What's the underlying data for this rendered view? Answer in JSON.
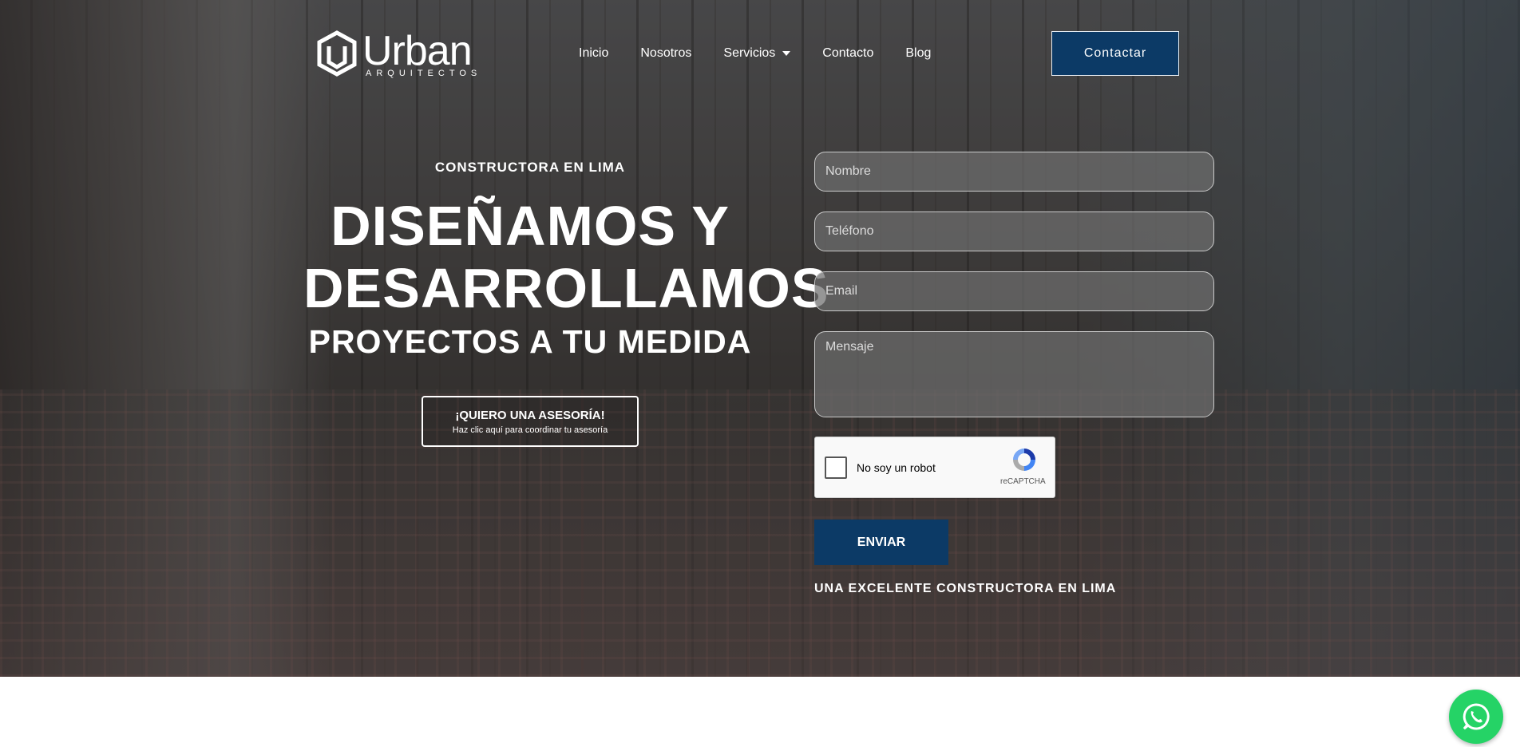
{
  "header": {
    "logo_text": "Urban",
    "logo_subtext": "ARQUITECTOS",
    "nav": [
      {
        "label": "Inicio"
      },
      {
        "label": "Nosotros"
      },
      {
        "label": "Servicios",
        "has_dropdown": true
      },
      {
        "label": "Contacto"
      },
      {
        "label": "Blog"
      }
    ],
    "contact_button": "Contactar"
  },
  "hero": {
    "eyebrow": "CONSTRUCTORA EN LIMA",
    "headline_line1": "DISEÑAMOS Y",
    "headline_line2": "DESARROLLAMOS",
    "subheadline": "PROYECTOS A TU MEDIDA",
    "cta_title": "¡QUIERO UNA ASESORÍA!",
    "cta_subtitle": "Haz clic aquí para coordinar tu asesoría"
  },
  "form": {
    "name_placeholder": "Nombre",
    "phone_placeholder": "Teléfono",
    "email_placeholder": "Email",
    "message_placeholder": "Mensaje",
    "recaptcha_label": "No soy un robot",
    "recaptcha_brand": "reCAPTCHA",
    "submit_label": "ENVIAR",
    "tagline": "UNA EXCELENTE CONSTRUCTORA EN LIMA"
  },
  "colors": {
    "primary": "#0c3a66",
    "whatsapp": "#25d366"
  },
  "icons": {
    "logo": "urban-logo-icon",
    "whatsapp": "whatsapp-icon",
    "dropdown": "chevron-down-icon",
    "recaptcha": "recaptcha-icon"
  }
}
